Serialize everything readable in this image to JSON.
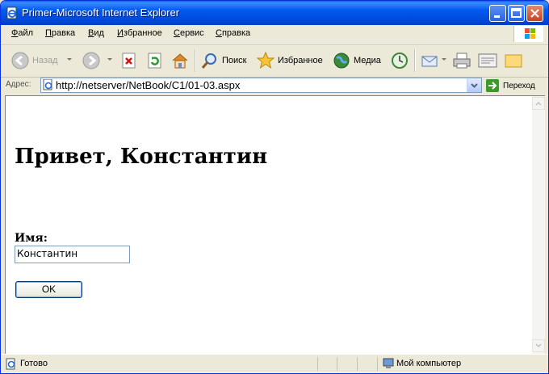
{
  "window": {
    "title": "Primer-Microsoft Internet Explorer"
  },
  "menu": [
    {
      "label": "Файл",
      "key": "Ф"
    },
    {
      "label": "Правка",
      "key": "П"
    },
    {
      "label": "Вид",
      "key": "В"
    },
    {
      "label": "Избранное",
      "key": "И"
    },
    {
      "label": "Сервис",
      "key": "С"
    },
    {
      "label": "Справка",
      "key": "С"
    }
  ],
  "toolbar": {
    "back": "Назад",
    "search": "Поиск",
    "favorites": "Избранное",
    "media": "Медиа"
  },
  "address": {
    "label": "Адрес:",
    "url": "http://netserver/NetBook/C1/01-03.aspx",
    "go": "Переход"
  },
  "page": {
    "heading": "Привет, Константин",
    "name_label": "Имя:",
    "name_value": "Константин",
    "ok_button": "OK"
  },
  "status": {
    "text": "Готово",
    "zone": "Мой компьютер"
  },
  "colors": {
    "titlebar": "#0058EE",
    "window_bg": "#ECE9D8"
  }
}
